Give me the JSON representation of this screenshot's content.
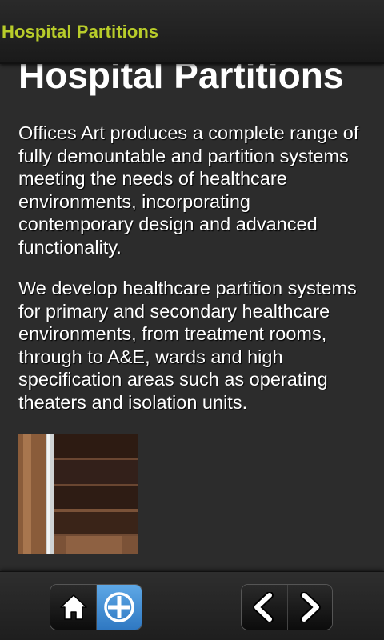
{
  "header": {
    "title": "Hospital Partitions"
  },
  "main": {
    "heading": "Hospital Partitions",
    "paragraphs": [
      "Offices Art produces a complete range of fully demountable and partition systems meeting the needs of healthcare environments, incorporating contemporary design and advanced functionality.",
      "We develop healthcare partition systems for primary and secondary healthcare environments, from treatment rooms, through to A&E, wards and high specification areas such as operating theaters and isolation units."
    ]
  },
  "footer": {
    "buttons": [
      {
        "icon": "home-icon",
        "active": false
      },
      {
        "icon": "plus-icon",
        "active": true
      },
      {
        "icon": "chevron-left-icon",
        "active": false
      },
      {
        "icon": "chevron-right-icon",
        "active": false
      }
    ]
  },
  "colors": {
    "accent": "#b8cc2a",
    "background": "#2c2c2c",
    "active_button": "#4a90d9"
  }
}
